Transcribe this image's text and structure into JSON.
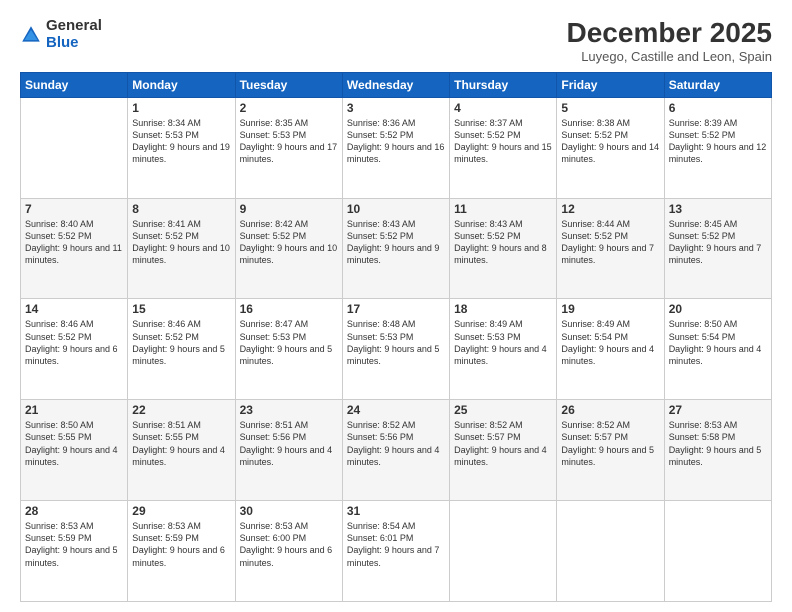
{
  "logo": {
    "general": "General",
    "blue": "Blue"
  },
  "header": {
    "month": "December 2025",
    "location": "Luyego, Castille and Leon, Spain"
  },
  "days": [
    "Sunday",
    "Monday",
    "Tuesday",
    "Wednesday",
    "Thursday",
    "Friday",
    "Saturday"
  ],
  "weeks": [
    [
      {
        "day": "",
        "sunrise": "",
        "sunset": "",
        "daylight": ""
      },
      {
        "day": "1",
        "sunrise": "Sunrise: 8:34 AM",
        "sunset": "Sunset: 5:53 PM",
        "daylight": "Daylight: 9 hours and 19 minutes."
      },
      {
        "day": "2",
        "sunrise": "Sunrise: 8:35 AM",
        "sunset": "Sunset: 5:53 PM",
        "daylight": "Daylight: 9 hours and 17 minutes."
      },
      {
        "day": "3",
        "sunrise": "Sunrise: 8:36 AM",
        "sunset": "Sunset: 5:52 PM",
        "daylight": "Daylight: 9 hours and 16 minutes."
      },
      {
        "day": "4",
        "sunrise": "Sunrise: 8:37 AM",
        "sunset": "Sunset: 5:52 PM",
        "daylight": "Daylight: 9 hours and 15 minutes."
      },
      {
        "day": "5",
        "sunrise": "Sunrise: 8:38 AM",
        "sunset": "Sunset: 5:52 PM",
        "daylight": "Daylight: 9 hours and 14 minutes."
      },
      {
        "day": "6",
        "sunrise": "Sunrise: 8:39 AM",
        "sunset": "Sunset: 5:52 PM",
        "daylight": "Daylight: 9 hours and 12 minutes."
      }
    ],
    [
      {
        "day": "7",
        "sunrise": "Sunrise: 8:40 AM",
        "sunset": "Sunset: 5:52 PM",
        "daylight": "Daylight: 9 hours and 11 minutes."
      },
      {
        "day": "8",
        "sunrise": "Sunrise: 8:41 AM",
        "sunset": "Sunset: 5:52 PM",
        "daylight": "Daylight: 9 hours and 10 minutes."
      },
      {
        "day": "9",
        "sunrise": "Sunrise: 8:42 AM",
        "sunset": "Sunset: 5:52 PM",
        "daylight": "Daylight: 9 hours and 10 minutes."
      },
      {
        "day": "10",
        "sunrise": "Sunrise: 8:43 AM",
        "sunset": "Sunset: 5:52 PM",
        "daylight": "Daylight: 9 hours and 9 minutes."
      },
      {
        "day": "11",
        "sunrise": "Sunrise: 8:43 AM",
        "sunset": "Sunset: 5:52 PM",
        "daylight": "Daylight: 9 hours and 8 minutes."
      },
      {
        "day": "12",
        "sunrise": "Sunrise: 8:44 AM",
        "sunset": "Sunset: 5:52 PM",
        "daylight": "Daylight: 9 hours and 7 minutes."
      },
      {
        "day": "13",
        "sunrise": "Sunrise: 8:45 AM",
        "sunset": "Sunset: 5:52 PM",
        "daylight": "Daylight: 9 hours and 7 minutes."
      }
    ],
    [
      {
        "day": "14",
        "sunrise": "Sunrise: 8:46 AM",
        "sunset": "Sunset: 5:52 PM",
        "daylight": "Daylight: 9 hours and 6 minutes."
      },
      {
        "day": "15",
        "sunrise": "Sunrise: 8:46 AM",
        "sunset": "Sunset: 5:52 PM",
        "daylight": "Daylight: 9 hours and 5 minutes."
      },
      {
        "day": "16",
        "sunrise": "Sunrise: 8:47 AM",
        "sunset": "Sunset: 5:53 PM",
        "daylight": "Daylight: 9 hours and 5 minutes."
      },
      {
        "day": "17",
        "sunrise": "Sunrise: 8:48 AM",
        "sunset": "Sunset: 5:53 PM",
        "daylight": "Daylight: 9 hours and 5 minutes."
      },
      {
        "day": "18",
        "sunrise": "Sunrise: 8:49 AM",
        "sunset": "Sunset: 5:53 PM",
        "daylight": "Daylight: 9 hours and 4 minutes."
      },
      {
        "day": "19",
        "sunrise": "Sunrise: 8:49 AM",
        "sunset": "Sunset: 5:54 PM",
        "daylight": "Daylight: 9 hours and 4 minutes."
      },
      {
        "day": "20",
        "sunrise": "Sunrise: 8:50 AM",
        "sunset": "Sunset: 5:54 PM",
        "daylight": "Daylight: 9 hours and 4 minutes."
      }
    ],
    [
      {
        "day": "21",
        "sunrise": "Sunrise: 8:50 AM",
        "sunset": "Sunset: 5:55 PM",
        "daylight": "Daylight: 9 hours and 4 minutes."
      },
      {
        "day": "22",
        "sunrise": "Sunrise: 8:51 AM",
        "sunset": "Sunset: 5:55 PM",
        "daylight": "Daylight: 9 hours and 4 minutes."
      },
      {
        "day": "23",
        "sunrise": "Sunrise: 8:51 AM",
        "sunset": "Sunset: 5:56 PM",
        "daylight": "Daylight: 9 hours and 4 minutes."
      },
      {
        "day": "24",
        "sunrise": "Sunrise: 8:52 AM",
        "sunset": "Sunset: 5:56 PM",
        "daylight": "Daylight: 9 hours and 4 minutes."
      },
      {
        "day": "25",
        "sunrise": "Sunrise: 8:52 AM",
        "sunset": "Sunset: 5:57 PM",
        "daylight": "Daylight: 9 hours and 4 minutes."
      },
      {
        "day": "26",
        "sunrise": "Sunrise: 8:52 AM",
        "sunset": "Sunset: 5:57 PM",
        "daylight": "Daylight: 9 hours and 5 minutes."
      },
      {
        "day": "27",
        "sunrise": "Sunrise: 8:53 AM",
        "sunset": "Sunset: 5:58 PM",
        "daylight": "Daylight: 9 hours and 5 minutes."
      }
    ],
    [
      {
        "day": "28",
        "sunrise": "Sunrise: 8:53 AM",
        "sunset": "Sunset: 5:59 PM",
        "daylight": "Daylight: 9 hours and 5 minutes."
      },
      {
        "day": "29",
        "sunrise": "Sunrise: 8:53 AM",
        "sunset": "Sunset: 5:59 PM",
        "daylight": "Daylight: 9 hours and 6 minutes."
      },
      {
        "day": "30",
        "sunrise": "Sunrise: 8:53 AM",
        "sunset": "Sunset: 6:00 PM",
        "daylight": "Daylight: 9 hours and 6 minutes."
      },
      {
        "day": "31",
        "sunrise": "Sunrise: 8:54 AM",
        "sunset": "Sunset: 6:01 PM",
        "daylight": "Daylight: 9 hours and 7 minutes."
      },
      {
        "day": "",
        "sunrise": "",
        "sunset": "",
        "daylight": ""
      },
      {
        "day": "",
        "sunrise": "",
        "sunset": "",
        "daylight": ""
      },
      {
        "day": "",
        "sunrise": "",
        "sunset": "",
        "daylight": ""
      }
    ]
  ]
}
